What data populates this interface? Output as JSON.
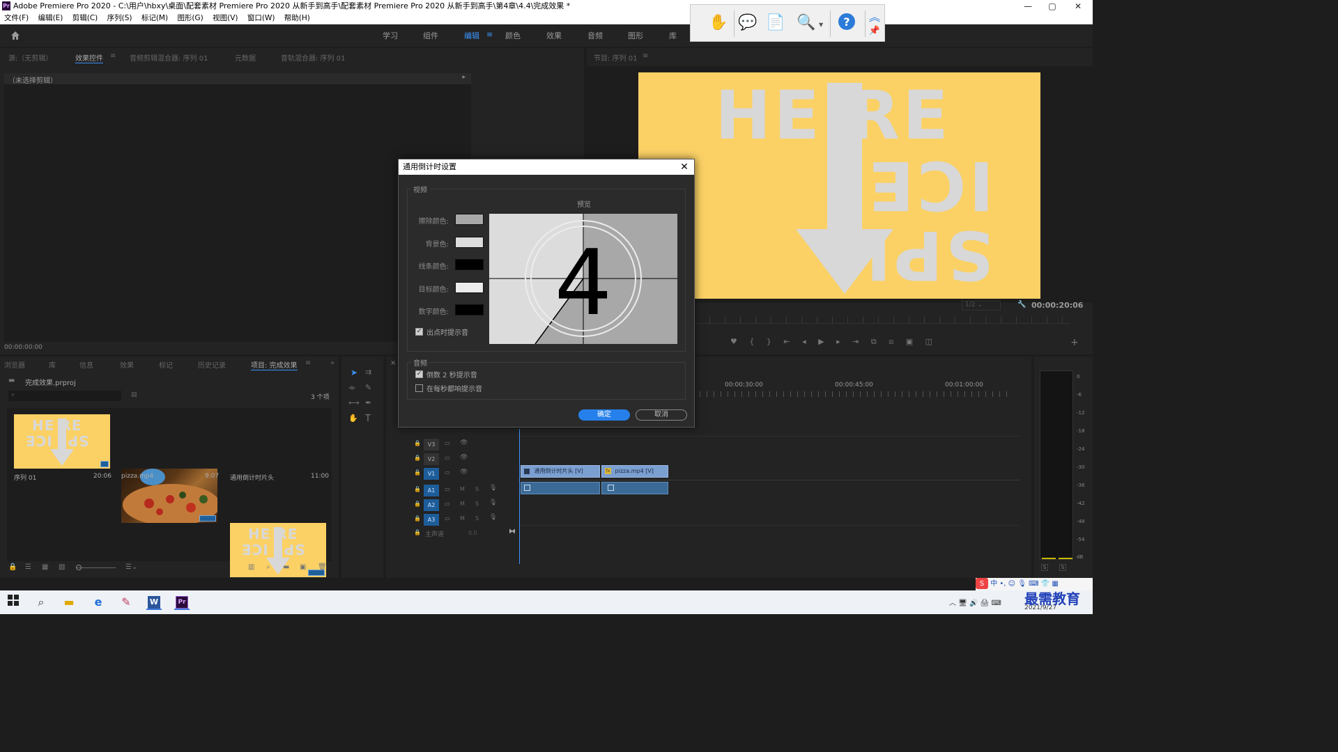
{
  "window": {
    "title": "Adobe Premiere Pro 2020 - C:\\用户\\hbxy\\桌面\\配套素材 Premiere Pro 2020 从新手到高手\\配套素材 Premiere Pro 2020 从新手到高手\\第4章\\4.4\\完成效果 *",
    "app_logo": "Pr",
    "min": "—",
    "max": "▢",
    "close": "✕"
  },
  "menu": [
    "文件(F)",
    "编辑(E)",
    "剪辑(C)",
    "序列(S)",
    "标记(M)",
    "图形(G)",
    "视图(V)",
    "窗口(W)",
    "帮助(H)"
  ],
  "workspaces": {
    "home_icon": "home-icon",
    "tabs": [
      "学习",
      "组件",
      "编辑",
      "颜色",
      "效果",
      "音频",
      "图形",
      "库"
    ],
    "active": "编辑"
  },
  "source_panel": {
    "tabs": [
      "源:（无剪辑）",
      "效果控件",
      "音频剪辑混合器: 序列 01",
      "元数据",
      "音轨混合器: 序列 01"
    ],
    "active_tab": "效果控件",
    "empty_text": "（未选择剪辑）",
    "timecode": "00:00:00:00"
  },
  "program_panel": {
    "tab": "节目: 序列 01",
    "image_text_top": "HE    RE",
    "image_text_bottom": "SPL    ICE",
    "zoom": "1/2",
    "timecode": "00:00:20:06"
  },
  "project_panel": {
    "tabs": [
      "浏览器",
      "库",
      "信息",
      "效果",
      "标记",
      "历史记录",
      "项目: 完成效果"
    ],
    "active_tab": "项目: 完成效果",
    "project_file": "完成效果.prproj",
    "item_count": "3 个项",
    "items": [
      {
        "name": "序列 01",
        "duration": "20:06"
      },
      {
        "name": "pizza.mp4",
        "duration": "9:07"
      },
      {
        "name": "通用倒计时片头",
        "duration": "11:00"
      }
    ]
  },
  "dialog": {
    "title": "通用倒计时设置",
    "close": "✕",
    "video_legend": "视频",
    "preview_label": "预览",
    "preview_number": "4",
    "colors": [
      {
        "label": "擦除颜色:",
        "value": "#a8a8a8"
      },
      {
        "label": "背景色:",
        "value": "#dcdcdc"
      },
      {
        "label": "线条颜色:",
        "value": "#000000"
      },
      {
        "label": "目标颜色:",
        "value": "#ececec"
      },
      {
        "label": "数字颜色:",
        "value": "#000000"
      }
    ],
    "cue_at_out": {
      "label": "出点时提示音",
      "checked": true
    },
    "audio_legend": "音频",
    "cue_2s": {
      "label": "倒数 2 秒提示音",
      "checked": true
    },
    "cue_every_second": {
      "label": "在每秒都响提示音",
      "checked": false
    },
    "ok": "确定",
    "cancel": "取消"
  },
  "timeline": {
    "ruler": [
      "00:00:30:00",
      "00:00:45:00",
      "00:01:00:00"
    ],
    "video_tracks": [
      "V3",
      "V2",
      "V1"
    ],
    "audio_tracks": [
      "A1",
      "A2",
      "A3"
    ],
    "master": "主声道",
    "master_value": "0.0",
    "clips": [
      {
        "name": "通用倒计时片头 [V]"
      },
      {
        "name": "pizza.mp4 [V]"
      }
    ],
    "toggle_m": "M",
    "toggle_s": "S"
  },
  "meter": {
    "scale": [
      "0",
      "-6",
      "-12",
      "-18",
      "-24",
      "-30",
      "-36",
      "-42",
      "-48",
      "-54",
      "dB"
    ],
    "buttons": [
      "S",
      "S"
    ]
  },
  "taskbar": {
    "date": "2021/9/27",
    "watermark": "最需教育",
    "ime": "中",
    "icons": [
      "windows-icon",
      "search-icon",
      "folder-icon",
      "edge-icon",
      "paint-icon",
      "word-icon",
      "premiere-icon"
    ]
  },
  "colors": {
    "accent": "#3b95ff",
    "program_bg": "#fbd166",
    "ok_button": "#2680eb"
  }
}
